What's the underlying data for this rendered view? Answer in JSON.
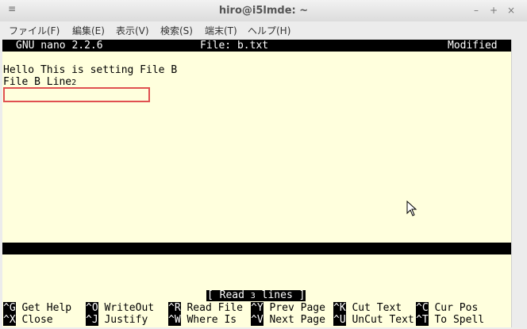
{
  "window": {
    "title": "hiro@i5lmde: ~",
    "menu_glyph": "≡",
    "minimize": "–",
    "maximize": "+",
    "close": "×"
  },
  "menubar": {
    "items": [
      {
        "label": "ファイル(F)"
      },
      {
        "label": "編集(E)"
      },
      {
        "label": "表示(V)"
      },
      {
        "label": "検索(S)"
      },
      {
        "label": "端末(T)"
      },
      {
        "label": "ヘルプ(H)"
      }
    ]
  },
  "nano": {
    "version": "GNU nano 2.2.6",
    "file": "File: b.txt",
    "state": "Modified",
    "lines": [
      "Hello This is setting File B",
      "File B Line"
    ],
    "line2_suffix": "2",
    "message_prefix": "[ Read ",
    "message_count": "3",
    "message_suffix": " lines ]",
    "shortcuts_row1": [
      {
        "key": "^G",
        "label": " Get Help"
      },
      {
        "key": "^O",
        "label": " WriteOut"
      },
      {
        "key": "^R",
        "label": " Read File"
      },
      {
        "key": "^Y",
        "label": " Prev Page"
      },
      {
        "key": "^K",
        "label": " Cut Text"
      },
      {
        "key": "^C",
        "label": " Cur Pos"
      }
    ],
    "shortcuts_row2": [
      {
        "key": "^X",
        "label": " Close"
      },
      {
        "key": "^J",
        "label": " Justify"
      },
      {
        "key": "^W",
        "label": " Where Is"
      },
      {
        "key": "^V",
        "label": " Next Page"
      },
      {
        "key": "^U",
        "label": " UnCut Text"
      },
      {
        "key": "^T",
        "label": " To Spell"
      }
    ]
  },
  "colors": {
    "terminal_bg": "#ffffdd",
    "highlight": "#e05050"
  }
}
